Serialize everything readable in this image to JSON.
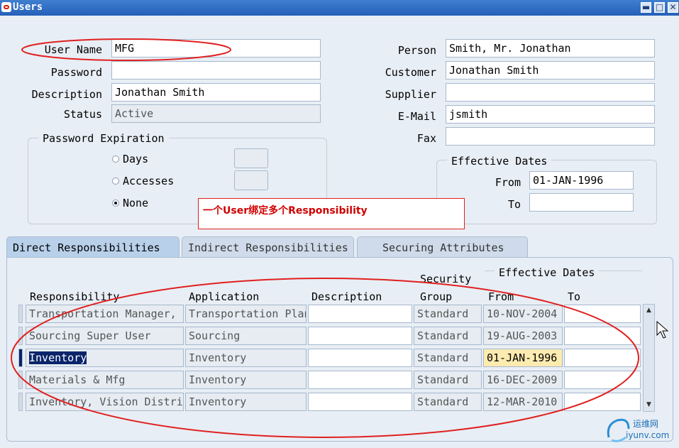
{
  "window": {
    "title": "Users",
    "minimize": "▬",
    "maximize": "□",
    "close": "✕"
  },
  "user": {
    "user_name_label": "User Name",
    "user_name": "MFG",
    "password_label": "Password",
    "password": "",
    "description_label": "Description",
    "description": "Jonathan Smith",
    "status_label": "Status",
    "status": "Active"
  },
  "password_expiration": {
    "legend": "Password Expiration",
    "days_label": "Days",
    "accesses_label": "Accesses",
    "none_label": "None",
    "selected": "None"
  },
  "person": {
    "person_label": "Person",
    "person": "Smith, Mr. Jonathan",
    "customer_label": "Customer",
    "customer": "Jonathan Smith",
    "supplier_label": "Supplier",
    "supplier": "",
    "email_label": "E-Mail",
    "email": "jsmith",
    "fax_label": "Fax",
    "fax": ""
  },
  "effective_dates": {
    "legend": "Effective Dates",
    "from_label": "From",
    "from": "01-JAN-1996",
    "to_label": "To",
    "to": ""
  },
  "annotation": {
    "text": "一个User绑定多个Responsibility",
    "color": "#d00000"
  },
  "tabs": [
    {
      "label": "Direct Responsibilities",
      "active": true
    },
    {
      "label": "Indirect Responsibilities",
      "active": false
    },
    {
      "label": "Securing Attributes",
      "active": false
    }
  ],
  "table": {
    "headers": {
      "responsibility": "Responsibility",
      "application": "Application",
      "description": "Description",
      "security_top": "Security",
      "security_group": "Group",
      "effective_dates": "Effective Dates",
      "from": "From",
      "to": "To"
    },
    "rows": [
      {
        "responsibility": "Transportation Manager,",
        "application": "Transportation Plan",
        "description": "",
        "security_group": "Standard",
        "from": "10-NOV-2004",
        "to": ""
      },
      {
        "responsibility": "Sourcing Super User",
        "application": "Sourcing",
        "description": "",
        "security_group": "Standard",
        "from": "19-AUG-2003",
        "to": ""
      },
      {
        "responsibility": "Inventory",
        "application": "Inventory",
        "description": "",
        "security_group": "Standard",
        "from": "01-JAN-1996",
        "to": ""
      },
      {
        "responsibility": "Materials & Mfg",
        "application": "Inventory",
        "description": "",
        "security_group": "Standard",
        "from": "16-DEC-2009",
        "to": ""
      },
      {
        "responsibility": "Inventory, Vision Distri",
        "application": "Inventory",
        "description": "",
        "security_group": "Standard",
        "from": "12-MAR-2010",
        "to": ""
      }
    ]
  },
  "watermark": {
    "line1": "运维网",
    "line2": "iyunv.com"
  },
  "colors": {
    "title_bar": "#2560b8",
    "annotation_ellipse": "#e02020",
    "current_row_highlight": "#fdebb0"
  }
}
